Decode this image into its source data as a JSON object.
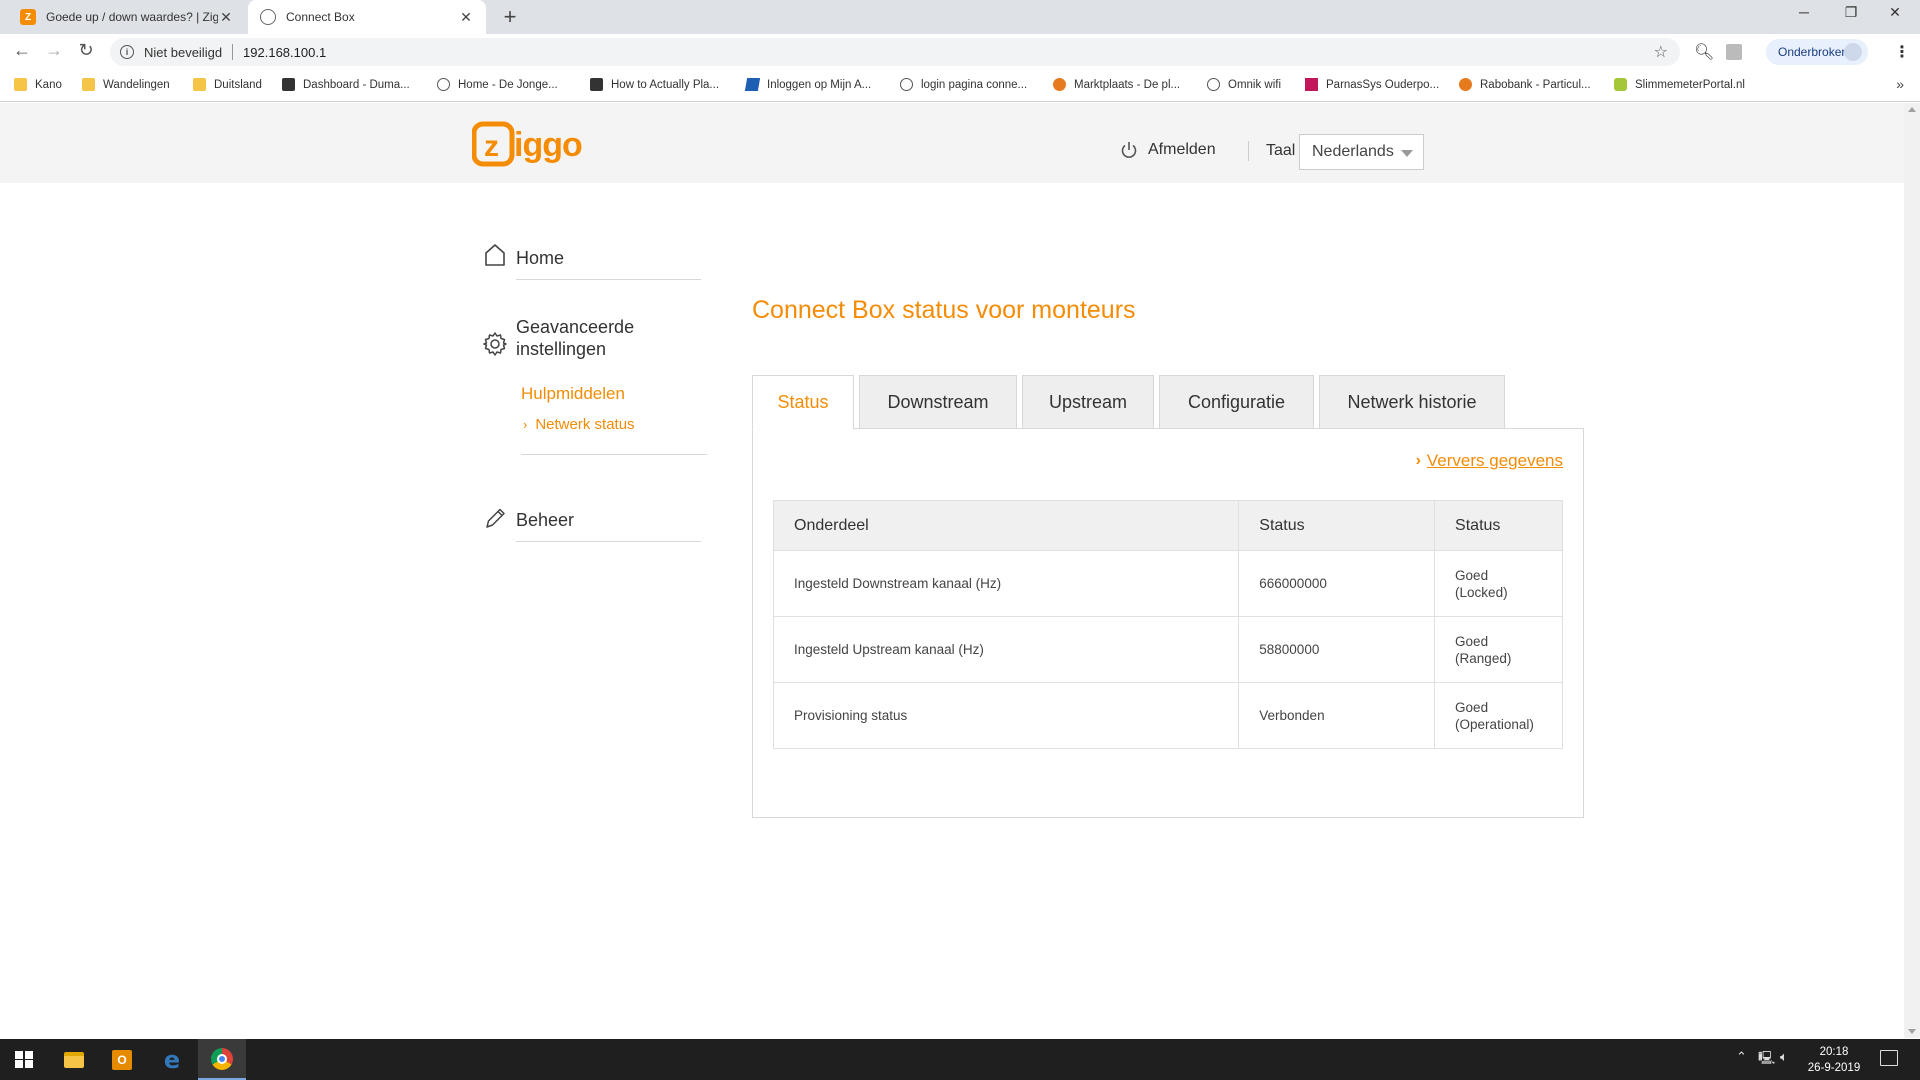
{
  "browser": {
    "tabs": [
      {
        "title": "Goede up / down waardes? | Zig",
        "active": false
      },
      {
        "title": "Connect Box",
        "active": true
      }
    ],
    "new_tab": "+",
    "address": {
      "security_label": "Niet beveiligd",
      "url": "192.168.100.1"
    },
    "profile_label": "Onderbroken",
    "bookmarks": [
      "Kano",
      "Wandelingen",
      "Duitsland",
      "Dashboard - Duma...",
      "Home - De Jonge...",
      "How to Actually Pla...",
      "Inloggen op Mijn A...",
      "login pagina conne...",
      "Marktplaats - De pl...",
      "Omnik wifi",
      "ParnasSys Ouderpo...",
      "Rabobank - Particul...",
      "SlimmemeterPortal.nl"
    ],
    "bookmarks_more": "»"
  },
  "header": {
    "logo_text": "ziggo",
    "logout_label": "Afmelden",
    "language_label": "Taal",
    "language_value": "Nederlands"
  },
  "sidebar": {
    "home": "Home",
    "advanced_line1": "Geavanceerde",
    "advanced_line2": "instellingen",
    "tools_header": "Hulpmiddelen",
    "network_status": "Netwerk status",
    "manage": "Beheer"
  },
  "main": {
    "title": "Connect Box status voor monteurs",
    "tabs": [
      "Status",
      "Downstream",
      "Upstream",
      "Configuratie",
      "Netwerk historie"
    ],
    "refresh_label": "Ververs gegevens",
    "table": {
      "headers": [
        "Onderdeel",
        "Status",
        "Status"
      ],
      "rows": [
        {
          "part": "Ingesteld Downstream kanaal (Hz)",
          "value": "666000000",
          "state1": "Goed",
          "state2": "(Locked)"
        },
        {
          "part": "Ingesteld Upstream kanaal (Hz)",
          "value": "58800000",
          "state1": "Goed",
          "state2": "(Ranged)"
        },
        {
          "part": "Provisioning status",
          "value": "Verbonden",
          "state1": "Goed",
          "state2": "(Operational)"
        }
      ]
    }
  },
  "taskbar": {
    "time": "20:18",
    "date": "26-9-2019"
  },
  "colors": {
    "accent": "#f48c06",
    "header_bg": "#f4f4f4",
    "taskbar_bg": "#1f1f1f"
  }
}
